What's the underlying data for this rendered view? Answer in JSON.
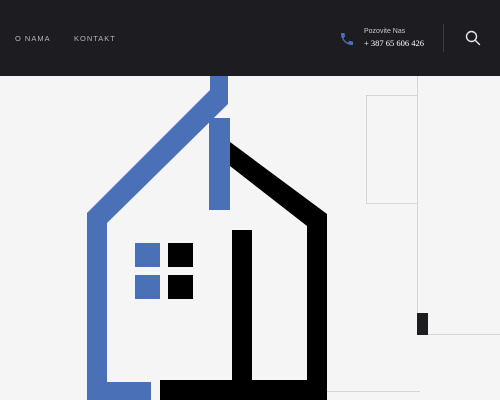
{
  "nav": {
    "items": [
      {
        "label": "O NAMA"
      },
      {
        "label": "KONTAKT"
      }
    ]
  },
  "contact": {
    "caption": "Pozovite Nas",
    "phone": "+ 387 65 606 426",
    "icon": "phone-icon"
  },
  "search": {
    "icon": "search-icon"
  },
  "colors": {
    "header_bg": "#1c1c21",
    "page_bg": "#f5f5f5",
    "brand_blue": "#4a70b8",
    "brand_black": "#000000"
  }
}
